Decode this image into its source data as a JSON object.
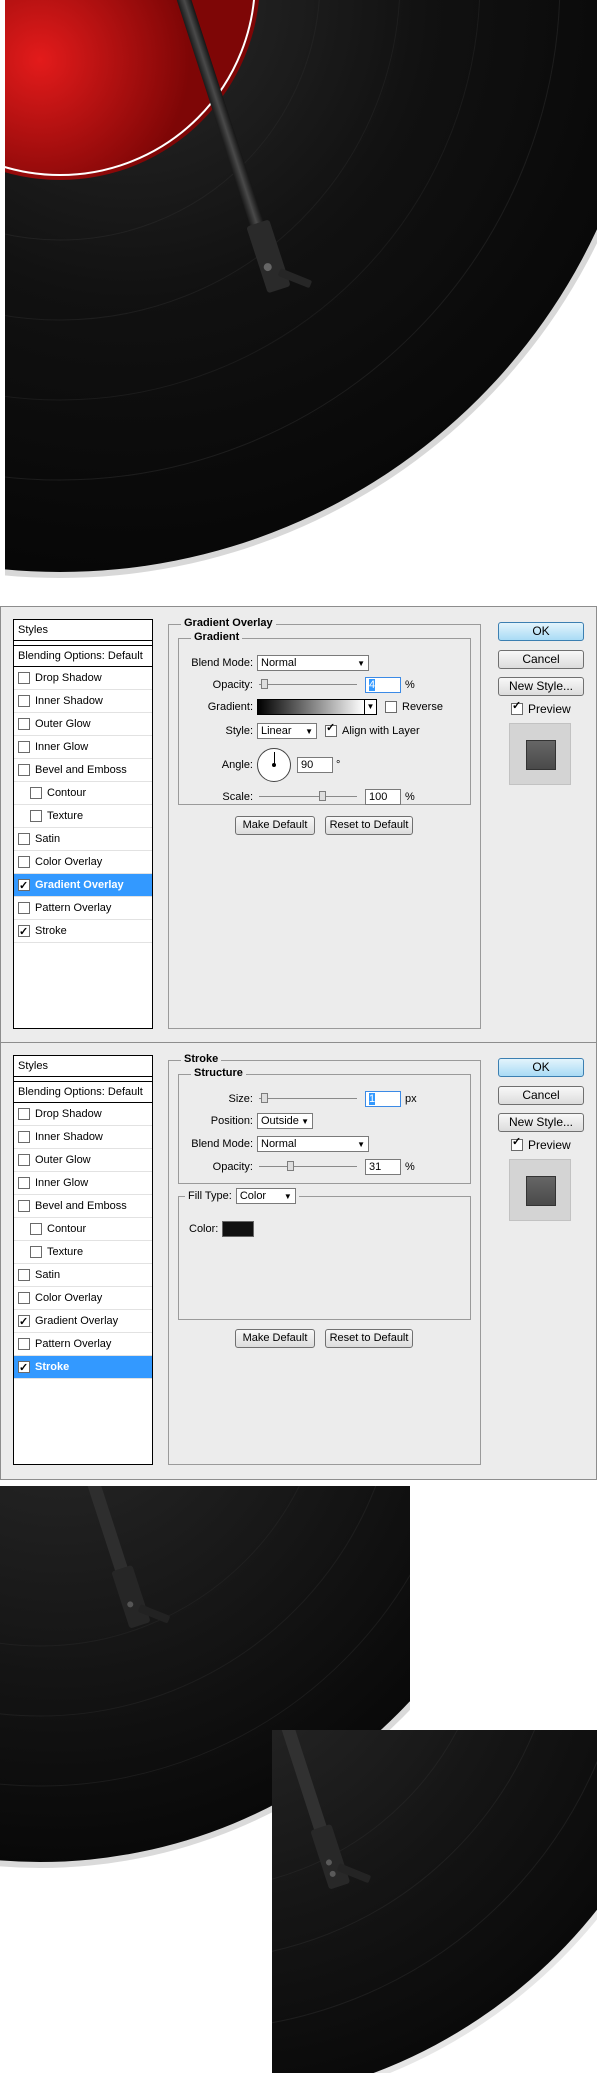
{
  "panel_common": {
    "styles_header": "Styles",
    "blending_options": "Blending Options: Default",
    "ok": "OK",
    "cancel": "Cancel",
    "new_style": "New Style...",
    "preview": "Preview",
    "make_default": "Make Default",
    "reset_to_default": "Reset to Default"
  },
  "dialog1": {
    "items": [
      {
        "label": "Drop Shadow",
        "checked": false,
        "sub": false,
        "selected": false
      },
      {
        "label": "Inner Shadow",
        "checked": false,
        "sub": false,
        "selected": false
      },
      {
        "label": "Outer Glow",
        "checked": false,
        "sub": false,
        "selected": false
      },
      {
        "label": "Inner Glow",
        "checked": false,
        "sub": false,
        "selected": false
      },
      {
        "label": "Bevel and Emboss",
        "checked": false,
        "sub": false,
        "selected": false
      },
      {
        "label": "Contour",
        "checked": false,
        "sub": true,
        "selected": false
      },
      {
        "label": "Texture",
        "checked": false,
        "sub": true,
        "selected": false
      },
      {
        "label": "Satin",
        "checked": false,
        "sub": false,
        "selected": false
      },
      {
        "label": "Color Overlay",
        "checked": false,
        "sub": false,
        "selected": false
      },
      {
        "label": "Gradient Overlay",
        "checked": true,
        "sub": false,
        "selected": true
      },
      {
        "label": "Pattern Overlay",
        "checked": false,
        "sub": false,
        "selected": false
      },
      {
        "label": "Stroke",
        "checked": true,
        "sub": false,
        "selected": false
      }
    ],
    "section_title": "Gradient Overlay",
    "group_title": "Gradient",
    "blend_mode_label": "Blend Mode:",
    "blend_mode_value": "Normal",
    "opacity_label": "Opacity:",
    "opacity_value": "4",
    "opacity_unit": "%",
    "gradient_label": "Gradient:",
    "reverse_label": "Reverse",
    "style_label": "Style:",
    "style_value": "Linear",
    "align_label": "Align with Layer",
    "angle_label": "Angle:",
    "angle_value": "90",
    "angle_unit": "°",
    "scale_label": "Scale:",
    "scale_value": "100",
    "scale_unit": "%"
  },
  "dialog2": {
    "items": [
      {
        "label": "Drop Shadow",
        "checked": false,
        "sub": false,
        "selected": false
      },
      {
        "label": "Inner Shadow",
        "checked": false,
        "sub": false,
        "selected": false
      },
      {
        "label": "Outer Glow",
        "checked": false,
        "sub": false,
        "selected": false
      },
      {
        "label": "Inner Glow",
        "checked": false,
        "sub": false,
        "selected": false
      },
      {
        "label": "Bevel and Emboss",
        "checked": false,
        "sub": false,
        "selected": false
      },
      {
        "label": "Contour",
        "checked": false,
        "sub": true,
        "selected": false
      },
      {
        "label": "Texture",
        "checked": false,
        "sub": true,
        "selected": false
      },
      {
        "label": "Satin",
        "checked": false,
        "sub": false,
        "selected": false
      },
      {
        "label": "Color Overlay",
        "checked": false,
        "sub": false,
        "selected": false
      },
      {
        "label": "Gradient Overlay",
        "checked": true,
        "sub": false,
        "selected": false
      },
      {
        "label": "Pattern Overlay",
        "checked": false,
        "sub": false,
        "selected": false
      },
      {
        "label": "Stroke",
        "checked": true,
        "sub": false,
        "selected": true
      }
    ],
    "section_title": "Stroke",
    "group_title": "Structure",
    "size_label": "Size:",
    "size_value": "1",
    "size_unit": "px",
    "position_label": "Position:",
    "position_value": "Outside",
    "blend_mode_label": "Blend Mode:",
    "blend_mode_value": "Normal",
    "opacity_label": "Opacity:",
    "opacity_value": "31",
    "opacity_unit": "%",
    "fill_type_label": "Fill Type:",
    "fill_type_value": "Color",
    "color_label": "Color:",
    "stroke_color": "#111111"
  },
  "colors": {
    "selection": "#3399ff",
    "record_label": "#c81010",
    "vinyl": "#141414"
  }
}
